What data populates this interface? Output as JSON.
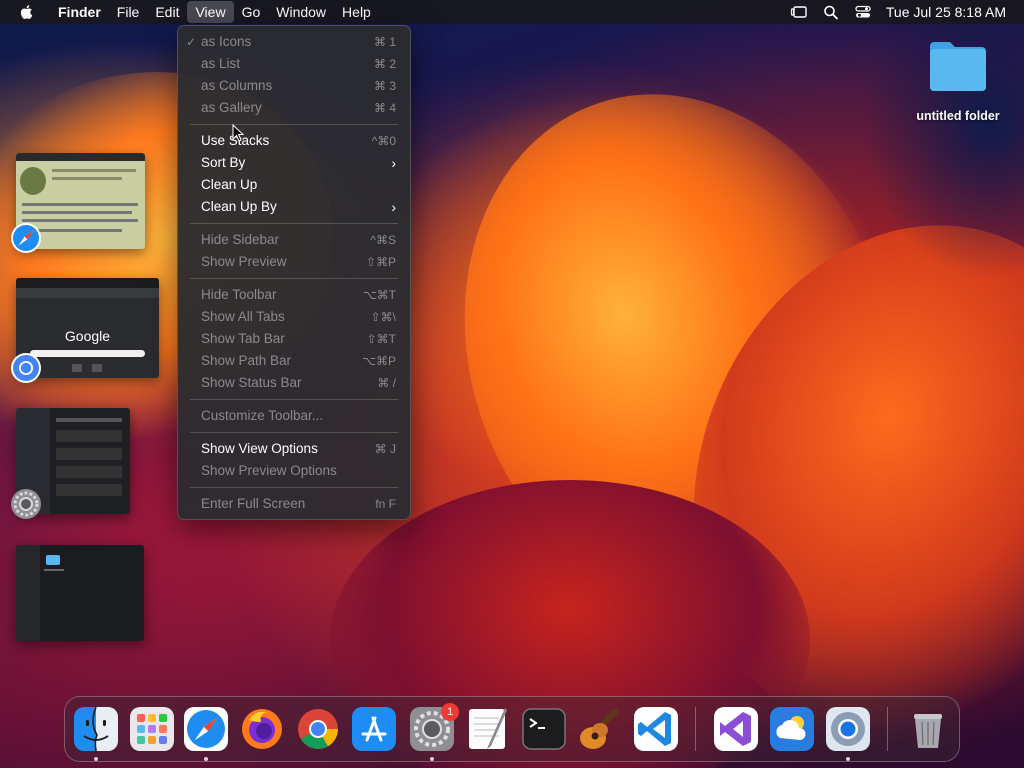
{
  "menubar": {
    "app_name": "Finder",
    "items": [
      "File",
      "Edit",
      "View",
      "Go",
      "Window",
      "Help"
    ],
    "active_item": "View",
    "clock": "Tue Jul 25  8:18 AM",
    "status_icons": [
      "stage-manager-icon",
      "spotlight-icon",
      "control-center-icon"
    ]
  },
  "view_menu": {
    "items": [
      {
        "label": "as Icons",
        "shortcut": "⌘ 1",
        "checked": true,
        "enabled": false
      },
      {
        "label": "as List",
        "shortcut": "⌘ 2",
        "enabled": false
      },
      {
        "label": "as Columns",
        "shortcut": "⌘ 3",
        "enabled": false
      },
      {
        "label": "as Gallery",
        "shortcut": "⌘ 4",
        "enabled": false
      },
      {
        "label": "Use Stacks",
        "shortcut": "^⌘0",
        "enabled": true
      },
      {
        "label": "Sort By",
        "submenu": true,
        "enabled": true
      },
      {
        "label": "Clean Up",
        "enabled": true
      },
      {
        "label": "Clean Up By",
        "submenu": true,
        "enabled": true
      },
      {
        "label": "Hide Sidebar",
        "shortcut": "^⌘S",
        "enabled": false
      },
      {
        "label": "Show Preview",
        "shortcut": "⇧⌘P",
        "enabled": false
      },
      {
        "label": "Hide Toolbar",
        "shortcut": "⌥⌘T",
        "enabled": false
      },
      {
        "label": "Show All Tabs",
        "shortcut": "⇧⌘\\",
        "enabled": false
      },
      {
        "label": "Show Tab Bar",
        "shortcut": "⇧⌘T",
        "enabled": false
      },
      {
        "label": "Show Path Bar",
        "shortcut": "⌥⌘P",
        "enabled": false
      },
      {
        "label": "Show Status Bar",
        "shortcut": "⌘ /",
        "enabled": false
      },
      {
        "label": "Customize Toolbar...",
        "enabled": false
      },
      {
        "label": "Show View Options",
        "shortcut": "⌘ J",
        "enabled": true
      },
      {
        "label": "Show Preview Options",
        "enabled": false
      },
      {
        "label": "Enter Full Screen",
        "shortcut": "fn F",
        "enabled": false
      }
    ]
  },
  "desktop": {
    "folder_label": "untitled folder"
  },
  "stage_manager": {
    "google_text": "Google"
  },
  "dock": {
    "apps": [
      "finder",
      "launchpad",
      "safari",
      "firefox",
      "chrome",
      "app-store",
      "system-settings",
      "textedit",
      "terminal",
      "garageband",
      "vscode",
      "visual-studio",
      "weather",
      "chrome-2",
      "trash"
    ],
    "settings_badge": "1"
  },
  "colors": {
    "menu_bg": "#2c2c30",
    "disabled_text": "#8a8a8e",
    "folder_blue": "#5ab8f0",
    "badge_red": "#ef3b36"
  }
}
